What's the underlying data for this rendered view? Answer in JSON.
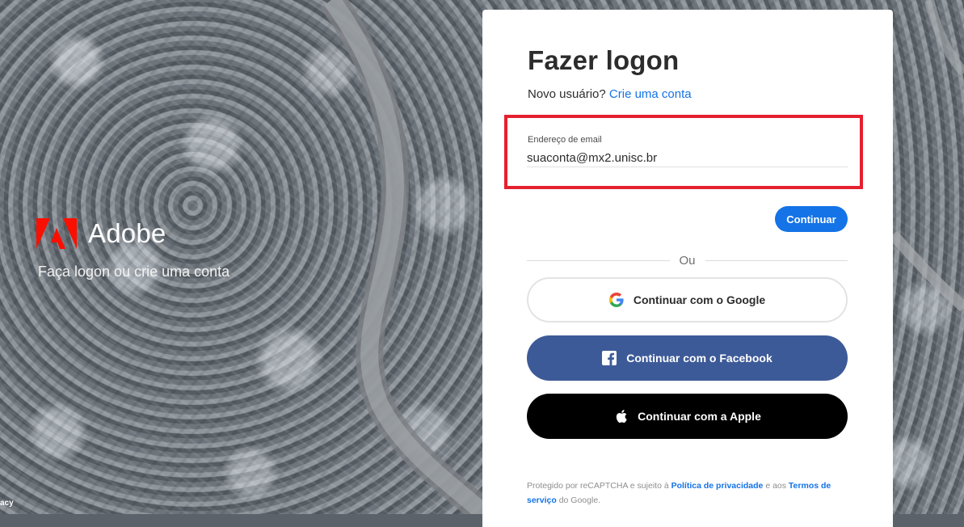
{
  "brand": {
    "name": "Adobe",
    "tagline": "Faça logon ou crie uma conta",
    "corner_text": "acy",
    "logo_color": "#fa0f00"
  },
  "signin": {
    "title": "Fazer logon",
    "new_user_prefix": "Novo usuário?",
    "create_account_link": "Crie uma conta",
    "email_label": "Endereço de email",
    "email_value": "suaconta@mx2.unisc.br",
    "continue_button": "Continuar",
    "divider_text": "Ou",
    "google_button": "Continuar com o Google",
    "facebook_button": "Continuar com o Facebook",
    "apple_button": "Continuar com a Apple"
  },
  "legal": {
    "prefix": "Protegido por reCAPTCHA e sujeito à",
    "privacy_link": "Política de privacidade",
    "middle": "e aos",
    "terms_link": "Termos de serviço",
    "suffix": "do Google."
  },
  "colors": {
    "accent": "#1473e6",
    "highlight_border": "#e5202e",
    "facebook": "#3d5a98",
    "apple": "#000000"
  }
}
